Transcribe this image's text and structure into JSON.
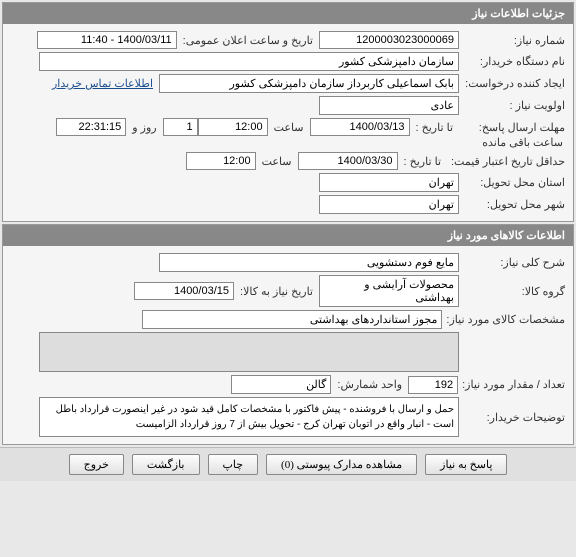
{
  "section1": {
    "title": "جزئیات اطلاعات نیاز",
    "need_number_label": "شماره نیاز:",
    "need_number": "1200003023000069",
    "announce_datetime_label": "تاریخ و ساعت اعلان عمومی:",
    "announce_datetime": "1400/03/11 - 11:40",
    "buyer_org_label": "نام دستگاه خریدار:",
    "buyer_org": "سازمان دامپزشکی کشور",
    "requester_label": "ایجاد کننده درخواست:",
    "requester": "بابک اسماعیلی کاربرداز سازمان دامپزشکی کشور",
    "contact_link": "اطلاعات تماس خریدار",
    "priority_label": "اولویت نیاز :",
    "priority": "عادی",
    "reply_deadline_label": "مهلت ارسال پاسخ:",
    "to_date_label": "تا تاریخ :",
    "reply_to_date": "1400/03/13",
    "time_label": "ساعت",
    "reply_time": "12:00",
    "days_value": "1",
    "days_label": "روز و",
    "remaining_time": "22:31:15",
    "remaining_label": "ساعت باقی مانده",
    "credit_min_label": "حداقل تاریخ اعتبار قیمت:",
    "credit_to_date": "1400/03/30",
    "credit_time": "12:00",
    "delivery_province_label": "استان محل تحویل:",
    "delivery_province": "تهران",
    "delivery_city_label": "شهر محل تحویل:",
    "delivery_city": "تهران"
  },
  "section2": {
    "title": "اطلاعات کالاهای مورد نیاز",
    "main_desc_label": "شرح کلی نیاز:",
    "main_desc": "مایع فوم دستشویی",
    "product_group_label": "گروه کالا:",
    "product_group": "محصولات آرایشی و بهداشتی",
    "need_by_date_label": "تاریخ نیاز به کالا:",
    "need_by_date": "1400/03/15",
    "spec_label": "مشخصات کالای مورد نیاز:",
    "spec_value": "مجوز استانداردهای بهداشتی",
    "products_placeholder": "",
    "qty_label": "تعداد / مقدار مورد نیاز:",
    "qty": "192",
    "unit_label": "واحد شمارش:",
    "unit": "گالن",
    "buyer_notes_label": "توضیحات خریدار:",
    "buyer_notes": "حمل و ارسال با فروشنده - پیش فاکتور با مشخصات کامل قید شود در غیر اینصورت قرارداد باطل است - انبار واقع در اتوبان تهران کرج - تحویل بیش از 7 روز قرارداد الزامیست"
  },
  "buttons": {
    "reply": "پاسخ به نیاز",
    "attachments": "مشاهده مدارک پیوستی (0)",
    "print": "چاپ",
    "back": "بازگشت",
    "exit": "خروج"
  }
}
